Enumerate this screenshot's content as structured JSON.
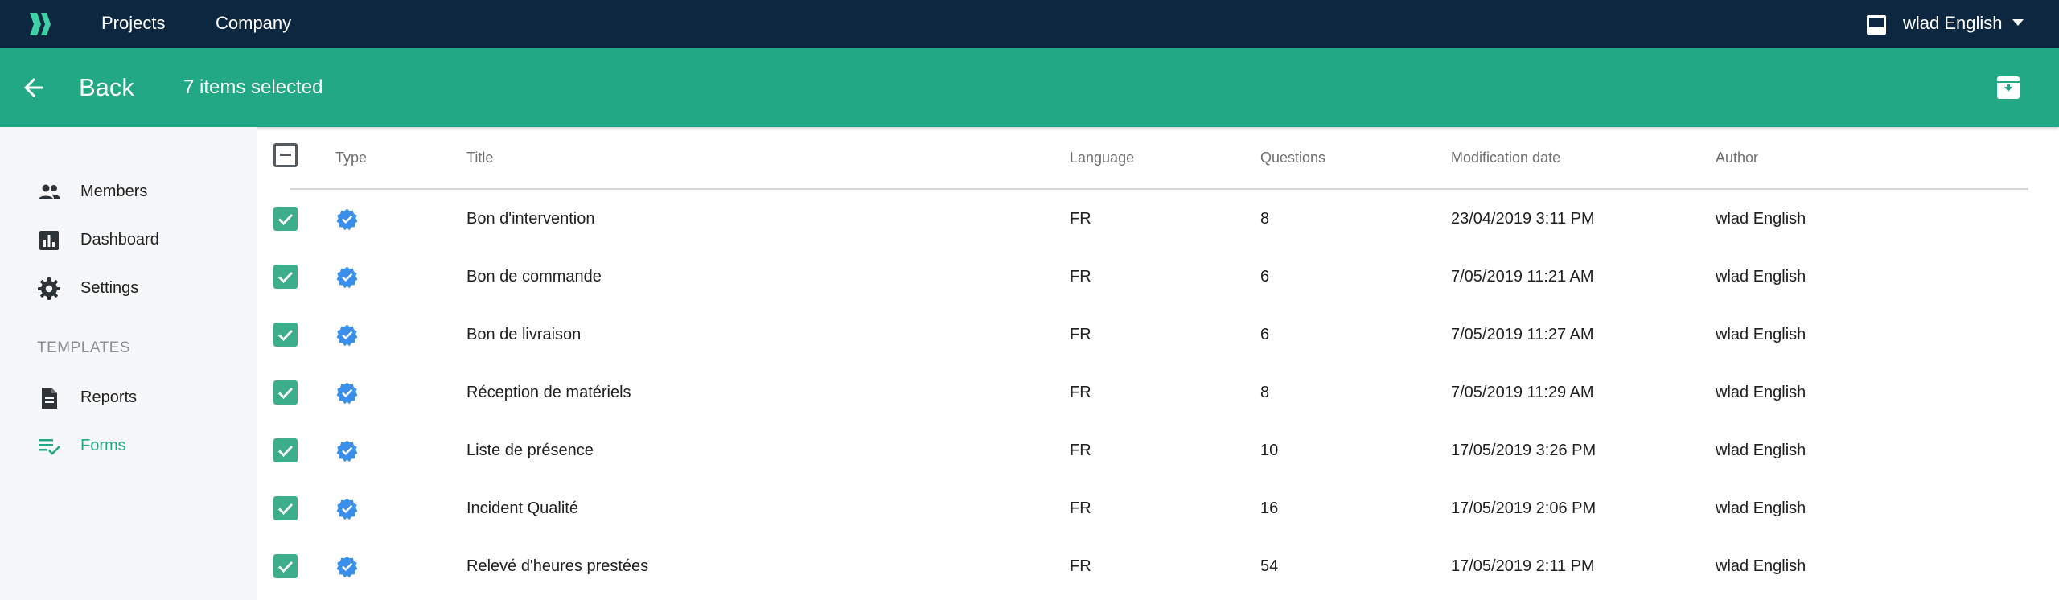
{
  "colors": {
    "topbar": "#0d2741",
    "selection_bar": "#22a884",
    "accent": "#22a884",
    "checkbox": "#3dae8a",
    "verified": "#3b8fe8",
    "sidebar_bg": "#f6f7f8"
  },
  "topbar": {
    "logo_icon": "chevrons-right-logo",
    "nav": [
      "Projects",
      "Company"
    ],
    "inbox_icon": "inbox-icon",
    "user_name": "wlad English"
  },
  "selection_bar": {
    "back_label": "Back",
    "selected_text": "7 items selected",
    "archive_icon": "archive-icon"
  },
  "sidebar": {
    "items": [
      {
        "label": "Members",
        "icon": "people-icon"
      },
      {
        "label": "Dashboard",
        "icon": "bar-chart-icon"
      },
      {
        "label": "Settings",
        "icon": "gear-icon"
      }
    ],
    "section_label": "TEMPLATES",
    "template_items": [
      {
        "label": "Reports",
        "icon": "document-icon",
        "active": false
      },
      {
        "label": "Forms",
        "icon": "checklist-icon",
        "active": true
      }
    ]
  },
  "table": {
    "headers": {
      "type": "Type",
      "title": "Title",
      "language": "Language",
      "questions": "Questions",
      "modified": "Modification date",
      "author": "Author"
    },
    "select_all_state": "indeterminate",
    "rows": [
      {
        "title": "Bon d'intervention",
        "language": "FR",
        "questions": "8",
        "modified": "23/04/2019 3:11 PM",
        "author": "wlad English",
        "checked": true,
        "type_icon": "verified-icon"
      },
      {
        "title": "Bon de commande",
        "language": "FR",
        "questions": "6",
        "modified": "7/05/2019 11:21 AM",
        "author": "wlad English",
        "checked": true,
        "type_icon": "verified-icon"
      },
      {
        "title": "Bon de livraison",
        "language": "FR",
        "questions": "6",
        "modified": "7/05/2019 11:27 AM",
        "author": "wlad English",
        "checked": true,
        "type_icon": "verified-icon"
      },
      {
        "title": "Réception de matériels",
        "language": "FR",
        "questions": "8",
        "modified": "7/05/2019 11:29 AM",
        "author": "wlad English",
        "checked": true,
        "type_icon": "verified-icon"
      },
      {
        "title": "Liste de présence",
        "language": "FR",
        "questions": "10",
        "modified": "17/05/2019 3:26 PM",
        "author": "wlad English",
        "checked": true,
        "type_icon": "verified-icon"
      },
      {
        "title": "Incident Qualité",
        "language": "FR",
        "questions": "16",
        "modified": "17/05/2019 2:06 PM",
        "author": "wlad English",
        "checked": true,
        "type_icon": "verified-icon"
      },
      {
        "title": "Relevé d'heures prestées",
        "language": "FR",
        "questions": "54",
        "modified": "17/05/2019 2:11 PM",
        "author": "wlad English",
        "checked": true,
        "type_icon": "verified-icon"
      }
    ]
  }
}
